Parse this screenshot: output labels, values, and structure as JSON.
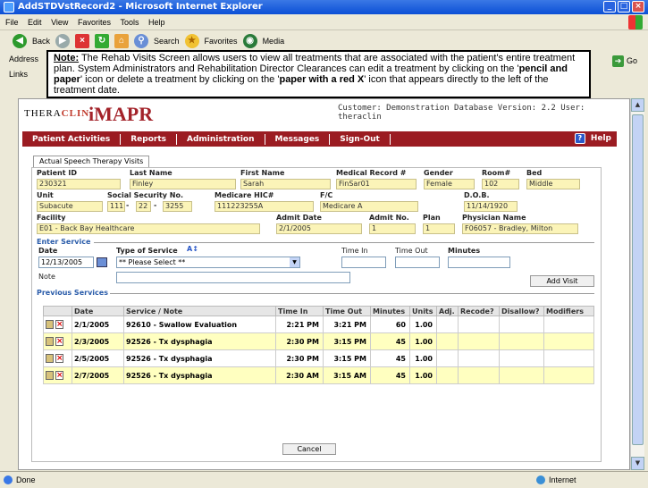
{
  "window": {
    "title": "AddSTDVstRecord2 - Microsoft Internet Explorer"
  },
  "menu": [
    "File",
    "Edit",
    "View",
    "Favorites",
    "Tools",
    "Help"
  ],
  "toolbar": {
    "back": "Back",
    "search": "Search",
    "favorites": "Favorites",
    "media": "Media"
  },
  "address": {
    "label": "Address",
    "go": "Go"
  },
  "links": {
    "label": "Links"
  },
  "note": {
    "prefix": "Note:",
    "text1": " The Rehab Visits Screen allows users to view all treatments that are associated with the patient's entire treatment plan. System Administrators and Rehabilitation Director Clearances can edit a treatment by clicking on the '",
    "bold1": "pencil and paper",
    "text2": "' icon or delete a treatment by clicking on the '",
    "bold2": "paper with a red X",
    "text3": "' icon that appears directly to the left of the treatment date."
  },
  "app": {
    "logo_thera": "THERA",
    "logo_clin": "CLIN",
    "logo_mapr": "iMAPR",
    "customer": "Customer: Demonstration Database Version: 2.2 User: theraclin",
    "nav": [
      "Patient Activities",
      "Reports",
      "Administration",
      "Messages",
      "Sign-Out"
    ],
    "help": "Help",
    "tab": "Actual Speech Therapy Visits"
  },
  "patient": {
    "labels": {
      "patient_id": "Patient ID",
      "last_name": "Last Name",
      "first_name": "First Name",
      "mrn": "Medical Record #",
      "gender": "Gender",
      "room": "Room#",
      "bed": "Bed",
      "unit": "Unit",
      "ssn": "Social Security No.",
      "medicare": "Medicare HIC#",
      "fc": "F/C",
      "dob": "D.O.B.",
      "facility": "Facility",
      "admit_date": "Admit Date",
      "admit_no": "Admit No.",
      "plan": "Plan",
      "physician": "Physician Name"
    },
    "patient_id": "230321",
    "last_name": "Finley",
    "first_name": "Sarah",
    "mrn": "FinSar01",
    "gender": "Female",
    "room": "102",
    "bed": "Middle",
    "unit": "Subacute",
    "ssn1": "111",
    "ssn2": "22",
    "ssn3": "3255",
    "medicare": "111223255A",
    "fc": "Medicare A",
    "dob": "11/14/1920",
    "facility": "E01 - Back Bay Healthcare",
    "admit_date": "2/1/2005",
    "admit_no": "1",
    "plan": "1",
    "physician": "F06057 - Bradley, Milton"
  },
  "enter_service": {
    "heading": "Enter Service",
    "date_label": "Date",
    "date_value": "12/13/2005",
    "type_label": "Type of Service",
    "type_value": "** Please Select **",
    "time_in_label": "Time In",
    "time_out_label": "Time Out",
    "minutes_label": "Minutes",
    "note_label": "Note",
    "add_visit": "Add Visit"
  },
  "previous": {
    "heading": "Previous Services",
    "columns": [
      "",
      "Date",
      "Service / Note",
      "Time In",
      "Time Out",
      "Minutes",
      "Units",
      "Adj.",
      "Recode?",
      "Disallow?",
      "Modifiers"
    ],
    "rows": [
      {
        "date": "2/1/2005",
        "service": "92610 - Swallow Evaluation",
        "time_in": "2:21 PM",
        "time_out": "3:21 PM",
        "minutes": "60",
        "units": "1.00"
      },
      {
        "date": "2/3/2005",
        "service": "92526 - Tx dysphagia",
        "time_in": "2:30 PM",
        "time_out": "3:15 PM",
        "minutes": "45",
        "units": "1.00"
      },
      {
        "date": "2/5/2005",
        "service": "92526 - Tx dysphagia",
        "time_in": "2:30 PM",
        "time_out": "3:15 PM",
        "minutes": "45",
        "units": "1.00"
      },
      {
        "date": "2/7/2005",
        "service": "92526 - Tx dysphagia",
        "time_in": "2:30 AM",
        "time_out": "3:15 AM",
        "minutes": "45",
        "units": "1.00"
      }
    ]
  },
  "cancel": "Cancel",
  "status": {
    "left": "Done",
    "zone": "Internet"
  }
}
